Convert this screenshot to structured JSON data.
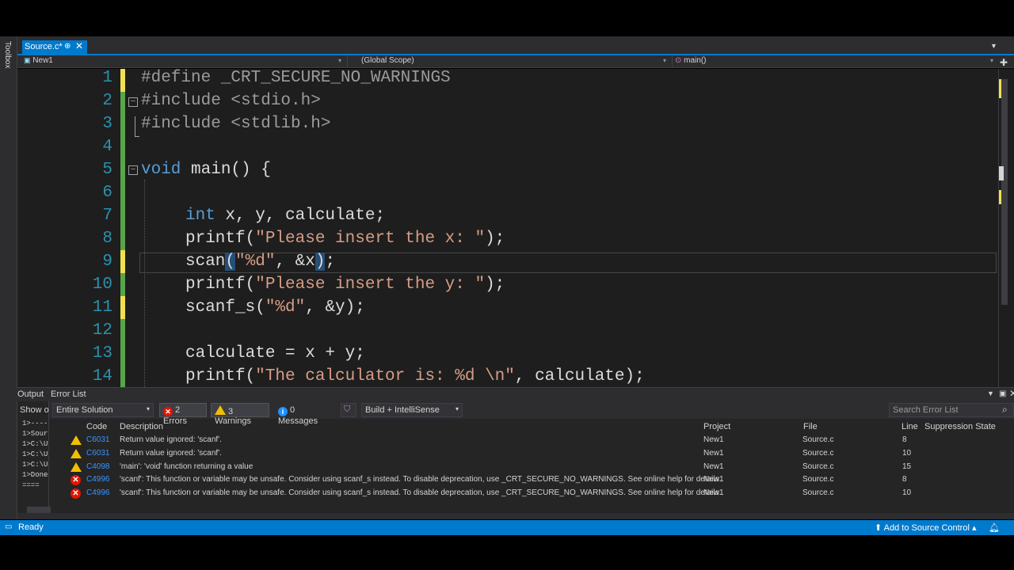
{
  "sidebar": {
    "toolbox_label": "Toolbox"
  },
  "tab": {
    "label": "Source.c*",
    "pin": "⊕",
    "close": "✕"
  },
  "nav": {
    "project": "New1",
    "scope": "(Global Scope)",
    "member": "main()"
  },
  "editor": {
    "lines": [
      {
        "n": "1"
      },
      {
        "n": "2"
      },
      {
        "n": "3"
      },
      {
        "n": "4"
      },
      {
        "n": "5"
      },
      {
        "n": "6"
      },
      {
        "n": "7"
      },
      {
        "n": "8"
      },
      {
        "n": "9"
      },
      {
        "n": "10"
      },
      {
        "n": "11"
      },
      {
        "n": "12"
      },
      {
        "n": "13"
      },
      {
        "n": "14"
      }
    ],
    "code": {
      "l1": "#define _CRT_SECURE_NO_WARNINGS",
      "l2": "#include <stdio.h>",
      "l3": "#include <stdlib.h>",
      "l5a": "void",
      "l5b": " main() {",
      "l7a": "int",
      "l7b": " x, y, calculate;",
      "l8a": "printf(",
      "l8b": "\"Please insert the x: \"",
      "l8c": ");",
      "l9a": "scan",
      "l9b": "(",
      "l9c": "\"%d\"",
      "l9d": ", &x",
      "l9e": ")",
      "l9f": ";",
      "l10a": "printf(",
      "l10b": "\"Please insert the y: \"",
      "l10c": ");",
      "l11a": "scanf_s(",
      "l11b": "\"%d\"",
      "l11c": ", &y);",
      "l13": "calculate = x + y;",
      "l14a": "printf(",
      "l14b": "\"The calculator is: %d \\n\"",
      "l14c": ", calculate);"
    }
  },
  "panel": {
    "tabs": {
      "output": "Output",
      "error_list": "Error List"
    },
    "show_output_label": "Show ou",
    "output_lines": [
      "1>----",
      "1>Sour",
      "1>C:\\U",
      "1>C:\\U",
      "1>C:\\U",
      "1>Done",
      "===="
    ],
    "filter": {
      "scope": "Entire Solution",
      "errors": "2 Errors",
      "warnings": "3 Warnings",
      "messages": "0 Messages",
      "build_mode": "Build + IntelliSense",
      "search_placeholder": "Search Error List"
    },
    "columns": {
      "code": "Code",
      "description": "Description",
      "project": "Project",
      "file": "File",
      "line": "Line",
      "suppression": "Suppression State"
    },
    "rows": [
      {
        "severity": "warning",
        "code": "C6031",
        "description": "Return value ignored: 'scanf'.",
        "project": "New1",
        "file": "Source.c",
        "line": "8"
      },
      {
        "severity": "warning",
        "code": "C6031",
        "description": "Return value ignored: 'scanf'.",
        "project": "New1",
        "file": "Source.c",
        "line": "10"
      },
      {
        "severity": "warning",
        "code": "C4098",
        "description": "'main': 'void' function returning a value",
        "project": "New1",
        "file": "Source.c",
        "line": "15"
      },
      {
        "severity": "error",
        "code": "C4996",
        "description": "'scanf': This function or variable may be unsafe. Consider using scanf_s instead. To disable deprecation, use _CRT_SECURE_NO_WARNINGS. See online help for details.",
        "project": "New1",
        "file": "Source.c",
        "line": "8"
      },
      {
        "severity": "error",
        "code": "C4996",
        "description": "'scanf': This function or variable may be unsafe. Consider using scanf_s instead. To disable deprecation, use _CRT_SECURE_NO_WARNINGS. See online help for details.",
        "project": "New1",
        "file": "Source.c",
        "line": "10"
      }
    ]
  },
  "status": {
    "ready": "Ready",
    "source_control": "Add to Source Control"
  },
  "colors": {
    "accent": "#007acc",
    "error": "#e51400",
    "warning": "#f0c000",
    "editor_bg": "#1e1e1e"
  }
}
